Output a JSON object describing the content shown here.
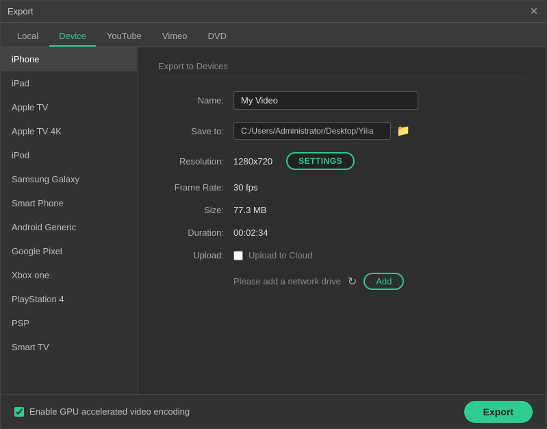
{
  "window": {
    "title": "Export"
  },
  "tabs": [
    {
      "label": "Local",
      "active": false
    },
    {
      "label": "Device",
      "active": true
    },
    {
      "label": "YouTube",
      "active": false
    },
    {
      "label": "Vimeo",
      "active": false
    },
    {
      "label": "DVD",
      "active": false
    }
  ],
  "sidebar": {
    "items": [
      {
        "label": "iPhone",
        "active": true
      },
      {
        "label": "iPad",
        "active": false
      },
      {
        "label": "Apple TV",
        "active": false
      },
      {
        "label": "Apple TV 4K",
        "active": false
      },
      {
        "label": "iPod",
        "active": false
      },
      {
        "label": "Samsung Galaxy",
        "active": false
      },
      {
        "label": "Smart Phone",
        "active": false
      },
      {
        "label": "Android Generic",
        "active": false
      },
      {
        "label": "Google Pixel",
        "active": false
      },
      {
        "label": "Xbox one",
        "active": false
      },
      {
        "label": "PlayStation 4",
        "active": false
      },
      {
        "label": "PSP",
        "active": false
      },
      {
        "label": "Smart TV",
        "active": false
      }
    ]
  },
  "content": {
    "section_title": "Export to Devices",
    "name_label": "Name:",
    "name_value": "My Video",
    "save_to_label": "Save to:",
    "save_to_path": "C:/Users/Administrator/Desktop/Yilia",
    "resolution_label": "Resolution:",
    "resolution_value": "1280x720",
    "settings_btn": "SETTINGS",
    "frame_rate_label": "Frame Rate:",
    "frame_rate_value": "30 fps",
    "size_label": "Size:",
    "size_value": "77.3 MB",
    "duration_label": "Duration:",
    "duration_value": "00:02:34",
    "upload_label": "Upload:",
    "upload_cloud_label": "Upload to Cloud",
    "network_text": "Please add a network drive",
    "add_btn": "Add"
  },
  "bottom": {
    "gpu_label": "Enable GPU accelerated video encoding",
    "export_btn": "Export"
  }
}
